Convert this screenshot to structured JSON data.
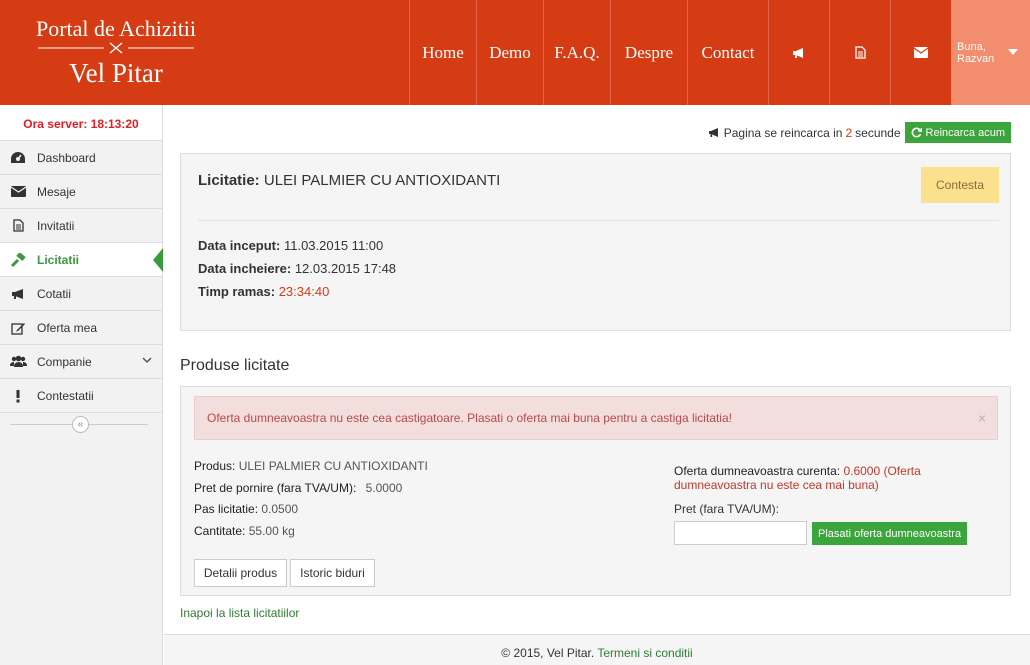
{
  "brand": {
    "line1": "Portal de Achizitii",
    "line2": "Vel Pitar"
  },
  "nav": {
    "items": [
      "Home",
      "Demo",
      "F.A.Q.",
      "Despre",
      "Contact"
    ],
    "icons": [
      "bullhorn-icon",
      "file-icon",
      "envelope-icon"
    ],
    "user_greeting": "Buna,",
    "user_name": "Razvan"
  },
  "sidebar": {
    "server_time": "Ora server: 18:13:20",
    "items": [
      {
        "label": "Dashboard",
        "icon": "dashboard-icon"
      },
      {
        "label": "Mesaje",
        "icon": "envelope-icon"
      },
      {
        "label": "Invitatii",
        "icon": "file-icon"
      },
      {
        "label": "Licitatii",
        "icon": "gavel-icon",
        "active": true
      },
      {
        "label": "Cotatii",
        "icon": "bullhorn-icon"
      },
      {
        "label": "Oferta mea",
        "icon": "edit-icon"
      },
      {
        "label": "Companie",
        "icon": "users-icon",
        "has_submenu": true
      },
      {
        "label": "Contestatii",
        "icon": "exclamation-icon"
      }
    ],
    "collapse_glyph": "«"
  },
  "reload": {
    "prefix": "Pagina se reincarca in",
    "seconds": "2",
    "suffix": "secunde",
    "button_label": "Reincarca acum"
  },
  "auction": {
    "title_label": "Licitatie:",
    "title_value": "ULEI PALMIER CU ANTIOXIDANTI",
    "contest_button": "Contesta",
    "start_label": "Data inceput:",
    "start_value": "11.03.2015 11:00",
    "end_label": "Data incheiere:",
    "end_value": "12.03.2015 17:48",
    "remaining_label": "Timp ramas:",
    "remaining_value": "23:34:40"
  },
  "products": {
    "section_title": "Produse licitate",
    "alert": "Oferta dumneavoastra nu este cea castigatoare. Plasati o oferta mai buna pentru a castiga licitatia!",
    "alert_close": "×",
    "produs_label": "Produs:",
    "produs_value": "ULEI PALMIER CU ANTIOXIDANTI",
    "pret_pornire_label": "Pret de pornire (fara TVA/UM):",
    "pret_pornire_value": "5.0000",
    "pas_label": "Pas licitatie:",
    "pas_value": "0.0500",
    "cantitate_label": "Cantitate:",
    "cantitate_value": "55.00 kg",
    "details_button": "Detalii produs",
    "history_button": "Istoric biduri",
    "current_offer_label": "Oferta dumneavoastra curenta:",
    "current_offer_value": "0.6000 (Oferta dumneavoastra nu este cea mai buna)",
    "price_field_label": "Pret (fara TVA/UM):",
    "price_field_value": "",
    "place_offer_button": "Plasati oferta dumneavoastra"
  },
  "back_link": "Inapoi la lista licitatiilor",
  "footer": {
    "copyright": "© 2015, Vel Pitar.",
    "terms_link": "Termeni si conditii"
  },
  "colors": {
    "header": "#d63c13",
    "user_box": "#f28d6e",
    "accent_green": "#3ba43b",
    "warning": "#fbe08d",
    "danger_text": "#b94a48"
  }
}
